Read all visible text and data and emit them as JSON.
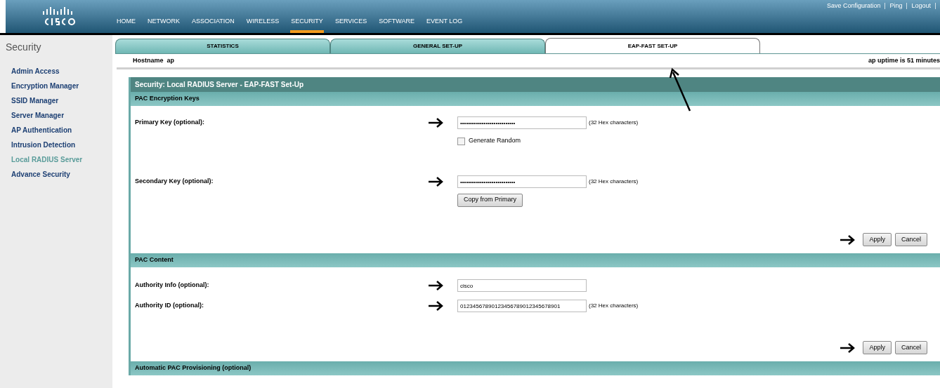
{
  "header": {
    "nav": [
      {
        "label": "HOME",
        "selected": false
      },
      {
        "label": "NETWORK",
        "selected": false
      },
      {
        "label": "ASSOCIATION",
        "selected": false
      },
      {
        "label": "WIRELESS",
        "selected": false
      },
      {
        "label": "SECURITY",
        "selected": true
      },
      {
        "label": "SERVICES",
        "selected": false
      },
      {
        "label": "SOFTWARE",
        "selected": false
      },
      {
        "label": "EVENT LOG",
        "selected": false
      }
    ],
    "links": [
      "Save Configuration",
      "Ping",
      "Logout"
    ]
  },
  "sidebar": {
    "title": "Security",
    "items": [
      {
        "label": "Admin Access",
        "selected": false
      },
      {
        "label": "Encryption Manager",
        "selected": false
      },
      {
        "label": "SSID Manager",
        "selected": false
      },
      {
        "label": "Server Manager",
        "selected": false
      },
      {
        "label": "AP Authentication",
        "selected": false
      },
      {
        "label": "Intrusion Detection",
        "selected": false
      },
      {
        "label": "Local RADIUS Server",
        "selected": true
      },
      {
        "label": "Advance Security",
        "selected": false
      }
    ]
  },
  "tabs": [
    {
      "label": "STATISTICS",
      "selected": false
    },
    {
      "label": "GENERAL SET-UP",
      "selected": false
    },
    {
      "label": "EAP-FAST SET-UP",
      "selected": true
    }
  ],
  "hostname": "Hostname  ap",
  "uptime": "ap uptime is 51 minutes",
  "panel": {
    "title": "Security: Local RADIUS Server - EAP-FAST Set-Up",
    "sections": [
      {
        "title": "PAC Encryption Keys",
        "rows": [
          {
            "kind": "input",
            "label": "Primary Key (optional):",
            "value": "••••••••••••••••••••••••••••",
            "hint": "(32 Hex characters)"
          },
          {
            "kind": "checkbox",
            "label": "Generate Random",
            "checked": false
          },
          {
            "kind": "input",
            "label": "Secondary Key (optional):",
            "value": "••••••••••••••••••••••••••••",
            "hint": "(32 Hex characters)"
          },
          {
            "kind": "button",
            "label": "Copy from Primary"
          }
        ],
        "buttons": [
          "Apply",
          "Cancel"
        ]
      },
      {
        "title": "PAC Content",
        "rows": [
          {
            "kind": "input",
            "label": "Authority Info (optional):",
            "value": "cisco"
          },
          {
            "kind": "input",
            "label": "Authority ID (optional):",
            "value": "01234567890123456789012345678901",
            "hint": "(32 Hex characters)"
          }
        ],
        "buttons": [
          "Apply",
          "Cancel"
        ]
      },
      {
        "title": "Automatic PAC Provisioning (optional)"
      }
    ]
  }
}
